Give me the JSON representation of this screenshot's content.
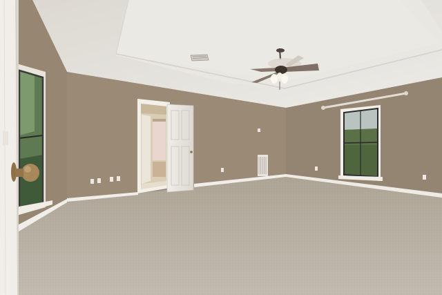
{
  "scene": {
    "kind": "empty bedroom interior photo",
    "elements": [
      "tray-ceiling",
      "ceiling-fan",
      "ceiling-air-vent",
      "left-window",
      "interior-door-open",
      "bathroom-glimpse",
      "right-window",
      "curtain-rod",
      "floor-air-vent",
      "wall-outlets",
      "thermostat",
      "carpet-floor",
      "baseboards",
      "foreground-door-with-knob"
    ]
  },
  "colors": {
    "wall": "#9a8a76",
    "wall_right": "#948472",
    "ceiling": "#e6e3dd",
    "ceiling_tray": "#ecebe7",
    "carpet": "#b9b1a4",
    "trim": "#f4f2ee",
    "knob": "#a8875b",
    "window_glass": "#5d7a52"
  }
}
